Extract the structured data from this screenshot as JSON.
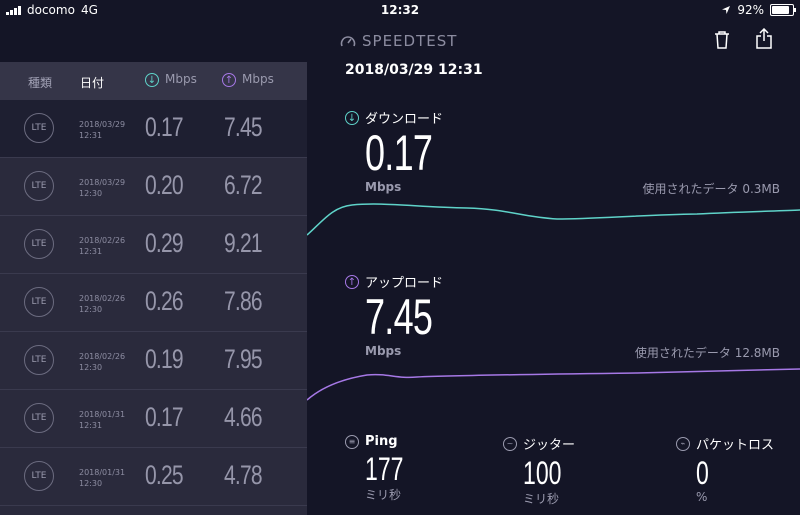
{
  "status_bar": {
    "carrier": "docomo",
    "network": "4G",
    "time": "12:32",
    "battery": "92%"
  },
  "app": {
    "logo": "SPEEDTEST"
  },
  "history": {
    "headers": {
      "type": "種類",
      "date": "日付",
      "download_unit": "Mbps",
      "upload_unit": "Mbps"
    },
    "rows": [
      {
        "type": "LTE",
        "date": "2018/03/29",
        "time": "12:31",
        "download": "0.17",
        "upload": "7.45"
      },
      {
        "type": "LTE",
        "date": "2018/03/29",
        "time": "12:30",
        "download": "0.20",
        "upload": "6.72"
      },
      {
        "type": "LTE",
        "date": "2018/02/26",
        "time": "12:31",
        "download": "0.29",
        "upload": "9.21"
      },
      {
        "type": "LTE",
        "date": "2018/02/26",
        "time": "12:30",
        "download": "0.26",
        "upload": "7.86"
      },
      {
        "type": "LTE",
        "date": "2018/02/26",
        "time": "12:30",
        "download": "0.19",
        "upload": "7.95"
      },
      {
        "type": "LTE",
        "date": "2018/01/31",
        "time": "12:31",
        "download": "0.17",
        "upload": "4.66"
      },
      {
        "type": "LTE",
        "date": "2018/01/31",
        "time": "12:30",
        "download": "0.25",
        "upload": "4.78"
      }
    ]
  },
  "detail": {
    "datetime": "2018/03/29 12:31",
    "download": {
      "label": "ダウンロード",
      "value": "0.17",
      "unit": "Mbps",
      "data_used": "使用されたデータ 0.3MB",
      "color": "#5fd3c9"
    },
    "upload": {
      "label": "アップロード",
      "value": "7.45",
      "unit": "Mbps",
      "data_used": "使用されたデータ 12.8MB",
      "color": "#a678e6"
    },
    "ping": {
      "label": "Ping",
      "value": "177",
      "unit": "ミリ秒"
    },
    "jitter": {
      "label": "ジッター",
      "value": "100",
      "unit": "ミリ秒"
    },
    "packet_loss": {
      "label": "パケットロス",
      "value": "0",
      "unit": "%"
    }
  }
}
